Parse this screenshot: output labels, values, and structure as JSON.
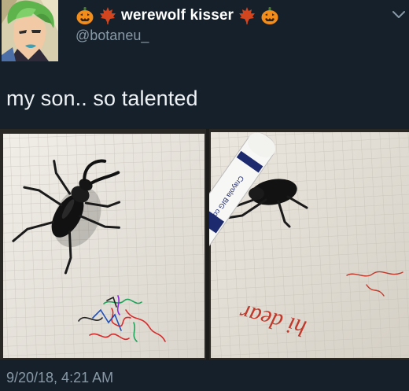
{
  "tweet": {
    "display_name": "werewolf kisser",
    "handle": "@botaneu_",
    "text": "my son.. so talented",
    "timestamp": "9/20/18, 4:21 AM",
    "name_emojis": [
      "jack-o-lantern-icon",
      "maple-leaf-icon",
      "maple-leaf-icon",
      "jack-o-lantern-icon"
    ]
  },
  "media": {
    "marker_label": "Crayola BIG colors",
    "handwriting": "hi dear"
  },
  "colors": {
    "background": "#15202b",
    "name": "#ffffff",
    "secondary": "#8899a6",
    "pumpkin": "#f28c1a",
    "leaf": "#d2451e"
  }
}
